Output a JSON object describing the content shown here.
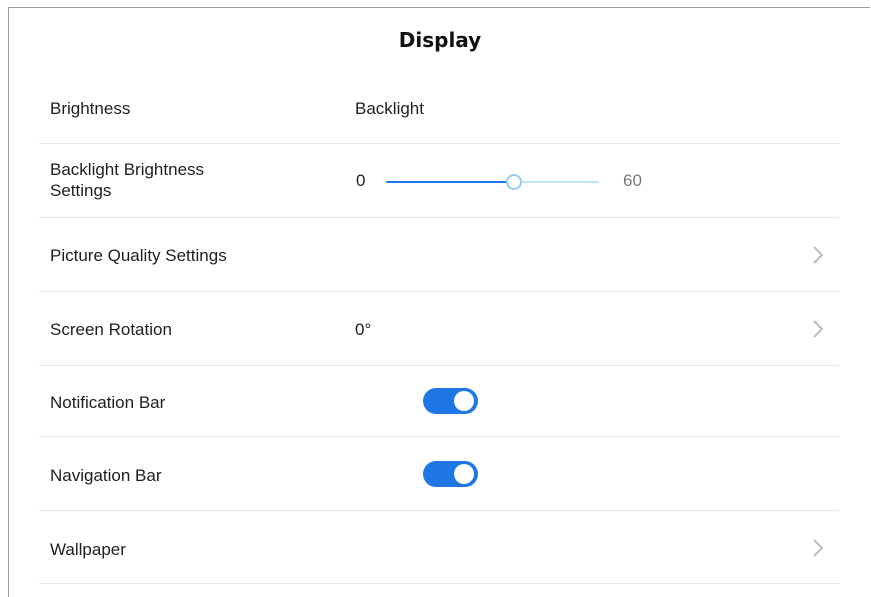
{
  "page": {
    "title": "Display"
  },
  "rows": {
    "brightness": {
      "label": "Brightness",
      "value": "Backlight"
    },
    "backlight_settings": {
      "label_line1": "Backlight Brightness",
      "label_line2": "Settings",
      "slider": {
        "min_label": "0",
        "max_label": "60",
        "fraction": 0.6
      }
    },
    "picture_quality": {
      "label": "Picture Quality Settings",
      "icon": "chevron-right-icon"
    },
    "screen_rotation": {
      "label": "Screen Rotation",
      "value": "0°",
      "icon": "chevron-right-icon"
    },
    "notification_bar": {
      "label": "Notification Bar",
      "enabled": true
    },
    "navigation_bar": {
      "label": "Navigation Bar",
      "enabled": true
    },
    "wallpaper": {
      "label": "Wallpaper",
      "icon": "chevron-right-icon"
    }
  },
  "colors": {
    "accent": "#1f77e5",
    "track_inactive": "#bfe3f7",
    "thumb_border": "#8ecdf0",
    "divider": "#e6e6e6",
    "chevron": "#bdbdbd"
  }
}
